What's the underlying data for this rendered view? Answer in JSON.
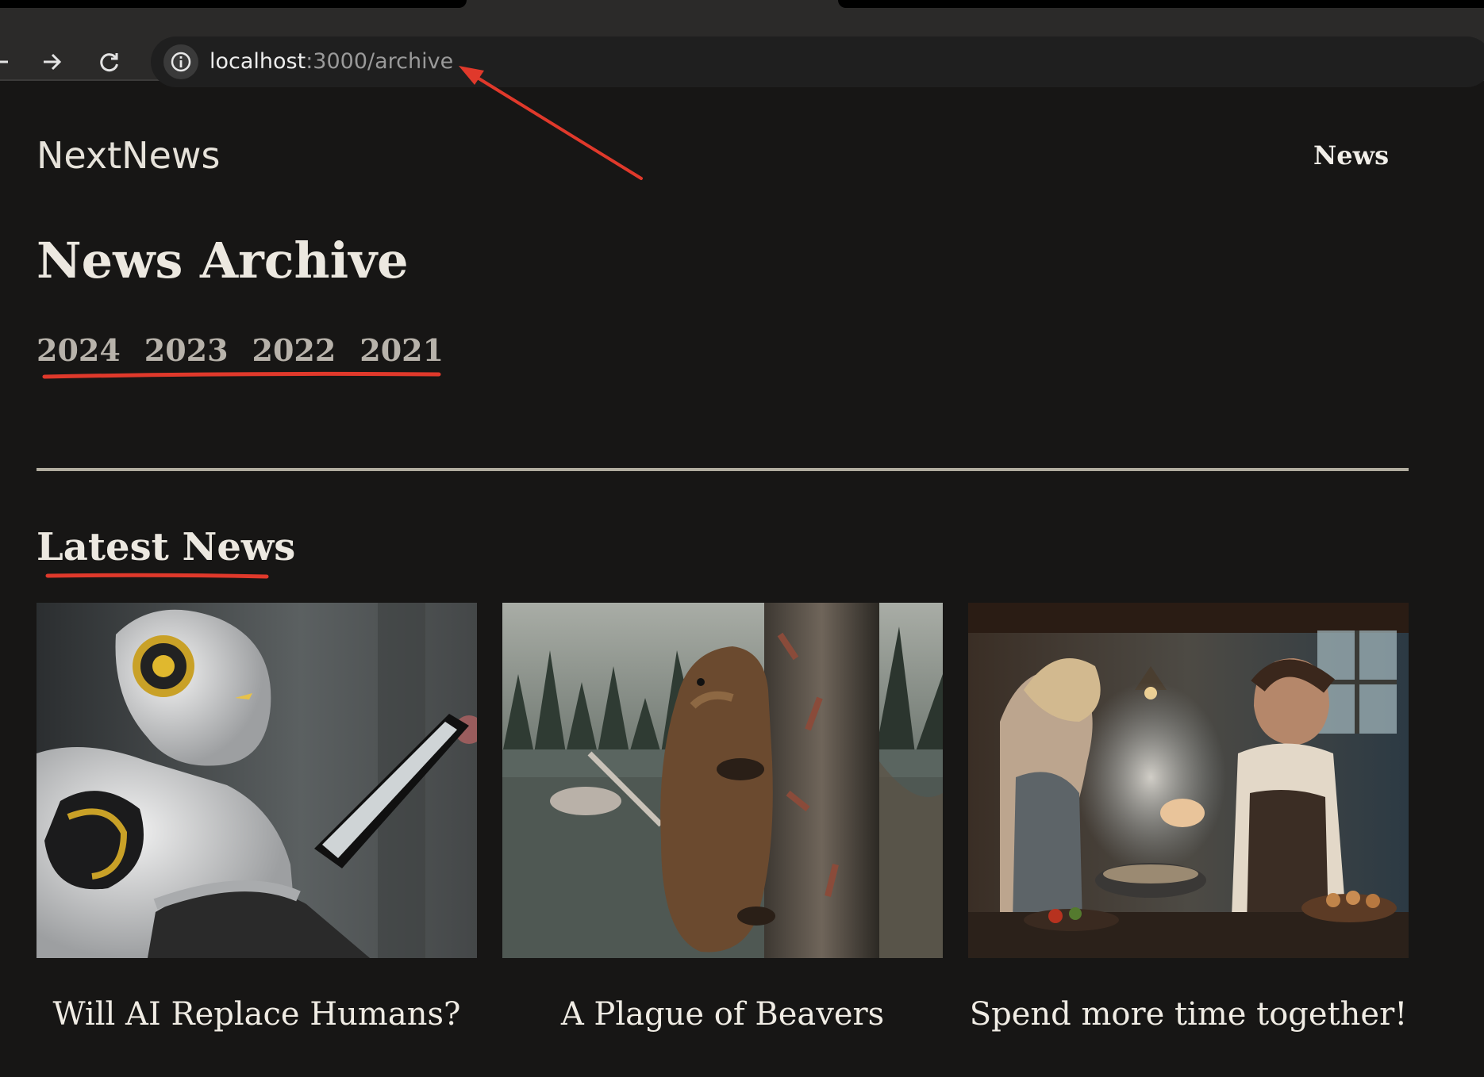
{
  "browser": {
    "url_host": "localhost",
    "url_path": ":3000/archive",
    "icons": {
      "forward": "arrow-right-icon",
      "reload": "reload-icon",
      "site_info": "info-icon"
    }
  },
  "header": {
    "logo": "NextNews",
    "nav": [
      "News"
    ]
  },
  "archive": {
    "title": "News Archive",
    "years": [
      "2024",
      "2023",
      "2022",
      "2021"
    ]
  },
  "latest": {
    "title": "Latest News",
    "articles": [
      {
        "title": "Will AI Replace Humans?",
        "image": "robot-reading-tablet"
      },
      {
        "title": "A Plague of Beavers",
        "image": "beaver-climbing-tree"
      },
      {
        "title": "Spend more time together!",
        "image": "couple-cooking-kitchen"
      }
    ]
  },
  "colors": {
    "background": "#171615",
    "annotation": "#e0392b",
    "divider": "#b1ad9f"
  }
}
